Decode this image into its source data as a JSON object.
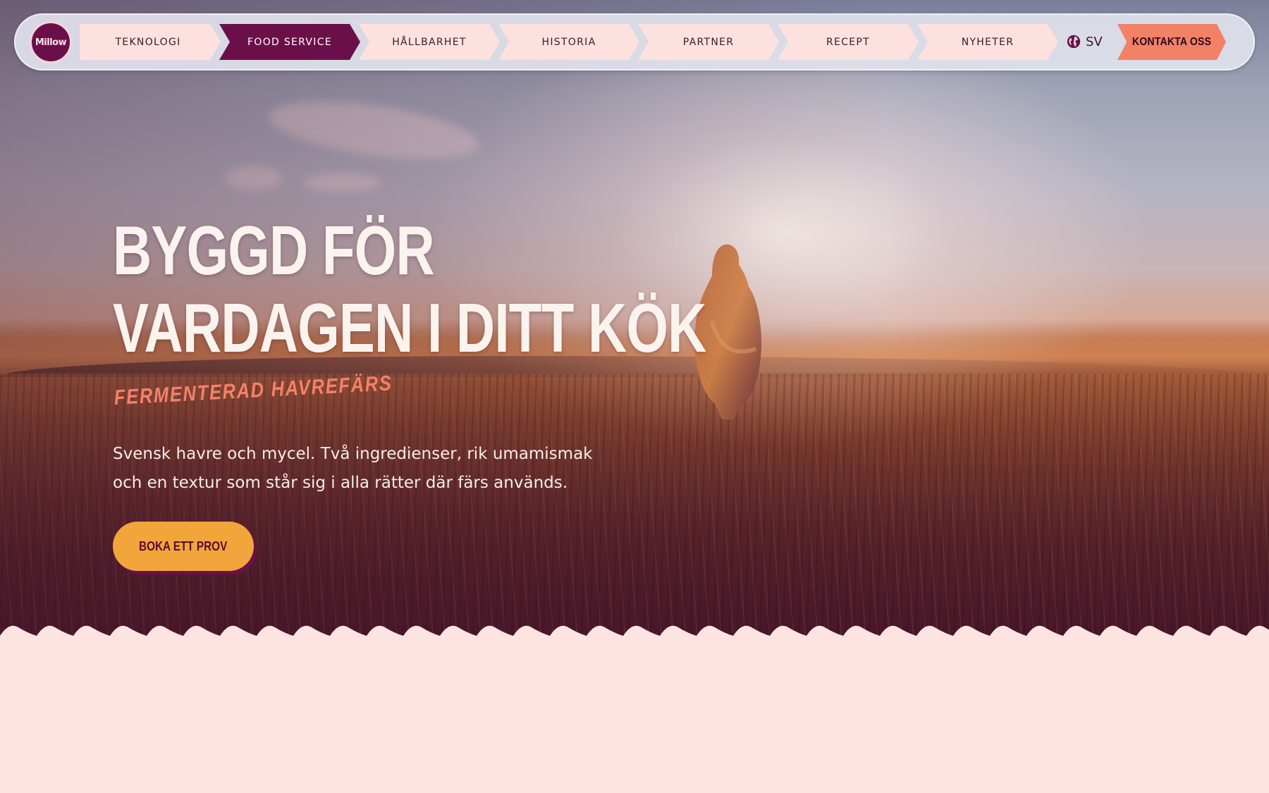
{
  "nav": {
    "logo_text": "Millow",
    "items": [
      {
        "label": "TEKNOLOGI",
        "active": false
      },
      {
        "label": "FOOD SERVICE",
        "active": true
      },
      {
        "label": "HÅLLBARHET",
        "active": false
      },
      {
        "label": "HISTORIA",
        "active": false
      },
      {
        "label": "PARTNER",
        "active": false
      },
      {
        "label": "RECEPT",
        "active": false
      },
      {
        "label": "NYHETER",
        "active": false
      }
    ],
    "language": {
      "icon": "globe-icon",
      "label": "SV"
    },
    "contact_label": "KONTAKTA OSS"
  },
  "hero": {
    "headline_line1": "BYGGD FÖR",
    "headline_line2": "VARDAGEN I DITT KÖK",
    "subtitle": "FERMENTERAD HAVREFÄRS",
    "body": "Svensk havre och mycel. Två ingredienser, rik umamismak och en textur som står sig i alla rätter där färs används.",
    "cta_label": "BOKA ETT PROV"
  },
  "colors": {
    "brand_purple": "#6b0f4a",
    "coral": "#f28166",
    "orange_cta": "#f2a53a",
    "page_bg": "#fde4e1",
    "nav_bg": "#e0e2eb"
  }
}
